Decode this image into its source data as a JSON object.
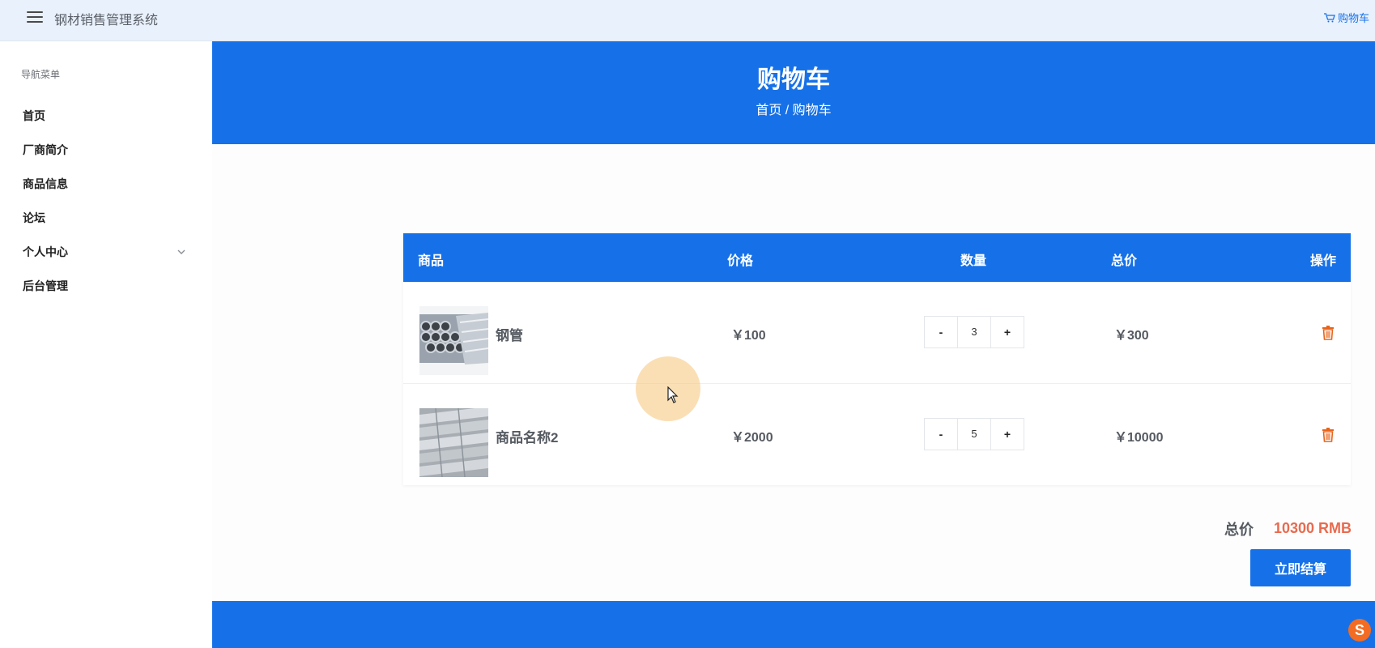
{
  "app": {
    "title": "钢材销售管理系统"
  },
  "header": {
    "cart_link": "购物车"
  },
  "sidebar": {
    "caption": "导航菜单",
    "items": [
      {
        "label": "首页"
      },
      {
        "label": "厂商简介"
      },
      {
        "label": "商品信息"
      },
      {
        "label": "论坛"
      },
      {
        "label": "个人中心",
        "icon": "chevron-down-icon"
      },
      {
        "label": "后台管理"
      }
    ]
  },
  "banner": {
    "title": "购物车",
    "breadcrumb": {
      "home": "首页",
      "separator": " / ",
      "current": "购物车"
    }
  },
  "cart": {
    "headers": {
      "product": "商品",
      "price": "价格",
      "quantity": "数量",
      "total": "总价",
      "action": "操作"
    },
    "rows": [
      {
        "name": "钢管",
        "price": "￥100",
        "qty": "3",
        "subtotal": "￥300",
        "minus": "-",
        "plus": "+"
      },
      {
        "name": "商品名称2",
        "price": "￥2000",
        "qty": "5",
        "subtotal": "￥10000",
        "minus": "-",
        "plus": "+"
      }
    ]
  },
  "summary": {
    "total_label": "总价",
    "total_value": "10300 RMB",
    "checkout_label": "立即结算"
  },
  "tray": {
    "badge": "S"
  },
  "colors": {
    "primary": "#1671e8",
    "accent": "#e96a4f",
    "trash": "#e8641b",
    "topbar": "#e9f1fc"
  }
}
